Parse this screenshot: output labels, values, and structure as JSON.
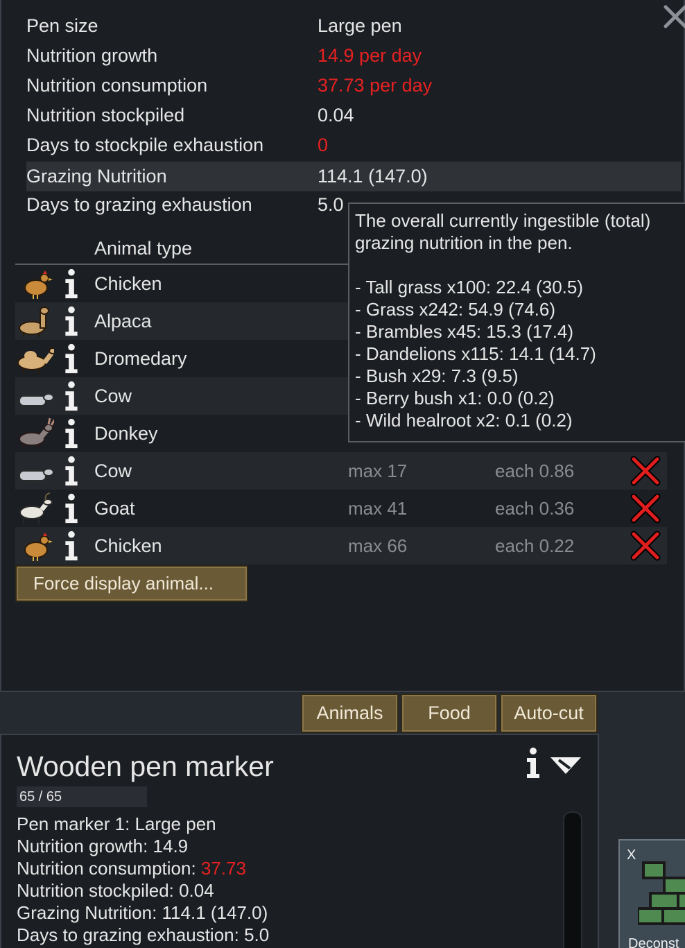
{
  "pen_stats": [
    {
      "label": "Pen size",
      "value": "Large pen",
      "value_color": "#e6e6e6"
    },
    {
      "label": "Nutrition growth",
      "value": "14.9 per day",
      "value_color": "#e62121"
    },
    {
      "label": "Nutrition consumption",
      "value": "37.73 per day",
      "value_color": "#e62121"
    },
    {
      "label": "Nutrition stockpiled",
      "value": "0.04",
      "value_color": "#e6e6e6"
    },
    {
      "label": "Days to stockpile exhaustion",
      "value": "0",
      "value_color": "#e62121"
    },
    {
      "label": "Grazing Nutrition",
      "value": "114.1 (147.0)",
      "value_color": "#e6e6e6",
      "highlighted": true
    },
    {
      "label": "Days to grazing exhaustion",
      "value": "5.0",
      "value_color": "#e6e6e6"
    }
  ],
  "animal_table": {
    "header": "Animal type",
    "rows": [
      {
        "icon": "chicken-icon",
        "name": "Chicken",
        "max": "",
        "each": "",
        "removable": false
      },
      {
        "icon": "alpaca-icon",
        "name": "Alpaca",
        "max": "",
        "each": "",
        "removable": false
      },
      {
        "icon": "dromedary-icon",
        "name": "Dromedary",
        "max": "",
        "each": "",
        "removable": false
      },
      {
        "icon": "cow-icon",
        "name": "Cow",
        "max": "",
        "each": "",
        "removable": false
      },
      {
        "icon": "donkey-icon",
        "name": "Donkey",
        "max": "",
        "each": "",
        "removable": false
      },
      {
        "icon": "cow-icon",
        "name": "Cow",
        "max": "max 17",
        "each": "each 0.86",
        "removable": true
      },
      {
        "icon": "goat-icon",
        "name": "Goat",
        "max": "max 41",
        "each": "each 0.36",
        "removable": true
      },
      {
        "icon": "chicken-icon",
        "name": "Chicken",
        "max": "max 66",
        "each": "each 0.22",
        "removable": true
      }
    ]
  },
  "force_display_button": "Force display animal...",
  "tooltip": {
    "description": "The overall currently ingestible (total) grazing nutrition in the pen.",
    "items": [
      "- Tall grass x100: 22.4 (30.5)",
      "- Grass x242: 54.9 (74.6)",
      "- Brambles x45: 15.3 (17.4)",
      "- Dandelions x115: 14.1 (14.7)",
      "- Bush x29: 7.3 (9.5)",
      "- Berry bush x1: 0.0 (0.2)",
      "- Wild healroot x2: 0.1 (0.2)"
    ]
  },
  "tabs": [
    "Animals",
    "Food",
    "Auto-cut"
  ],
  "inspect": {
    "title": "Wooden pen marker",
    "hp": "65 / 65",
    "lines": [
      {
        "text": "Pen marker 1: Large pen",
        "suffix": ""
      },
      {
        "text": "Nutrition growth: 14.9",
        "suffix": ""
      },
      {
        "text": "Nutrition consumption: ",
        "suffix": "37.73"
      },
      {
        "text": "Nutrition stockpiled: 0.04",
        "suffix": ""
      },
      {
        "text": "Grazing Nutrition: 114.1 (147.0)",
        "suffix": ""
      },
      {
        "text": "Days to grazing exhaustion: 5.0",
        "suffix": ""
      }
    ]
  },
  "gizmo": {
    "hotkey": "X",
    "label": "Deconst"
  },
  "colors": {
    "warning": "#e62121",
    "button": "#6b5a36",
    "panel": "#1b1e23"
  }
}
